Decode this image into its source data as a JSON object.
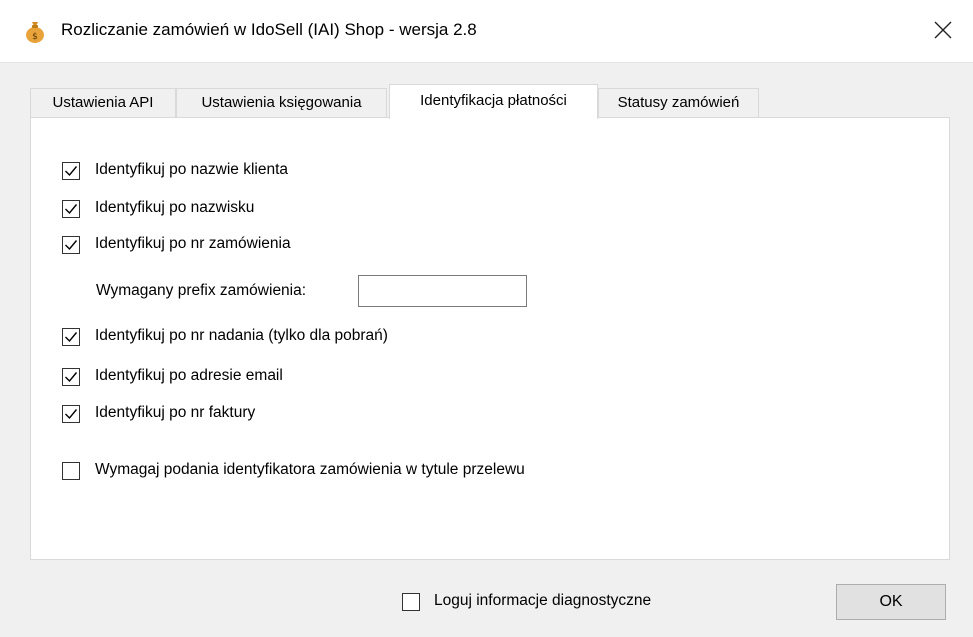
{
  "window": {
    "title": "Rozliczanie zamówień w IdoSell (IAI) Shop - wersja 2.8",
    "app_icon": "money-bag-icon",
    "close_icon": "close-icon"
  },
  "tabs": [
    {
      "label": "Ustawienia API",
      "selected": false
    },
    {
      "label": "Ustawienia księgowania",
      "selected": false
    },
    {
      "label": "Identyfikacja płatności",
      "selected": true
    },
    {
      "label": "Statusy zamówień",
      "selected": false
    }
  ],
  "options": [
    {
      "label": "Identyfikuj po nazwie klienta",
      "checked": true
    },
    {
      "label": "Identyfikuj po nazwisku",
      "checked": true
    },
    {
      "label": "Identyfikuj po nr zamówienia",
      "checked": true
    },
    {
      "label": "Identyfikuj po nr nadania (tylko dla pobrań)",
      "checked": true
    },
    {
      "label": "Identyfikuj po adresie email",
      "checked": true
    },
    {
      "label": "Identyfikuj po nr faktury",
      "checked": true
    },
    {
      "label": "Wymagaj podania identyfikatora zamówienia w tytule przelewu",
      "checked": false
    }
  ],
  "prefix": {
    "label": "Wymagany prefix zamówienia:",
    "value": ""
  },
  "footer": {
    "diagnostics_label": "Loguj informacje diagnostyczne",
    "diagnostics_checked": false,
    "ok_label": "OK"
  },
  "colors": {
    "accent_check": "#000000",
    "panel_bg": "#ffffff",
    "window_bg": "#f0f0f0",
    "icon_bag": "#e8a33a"
  }
}
